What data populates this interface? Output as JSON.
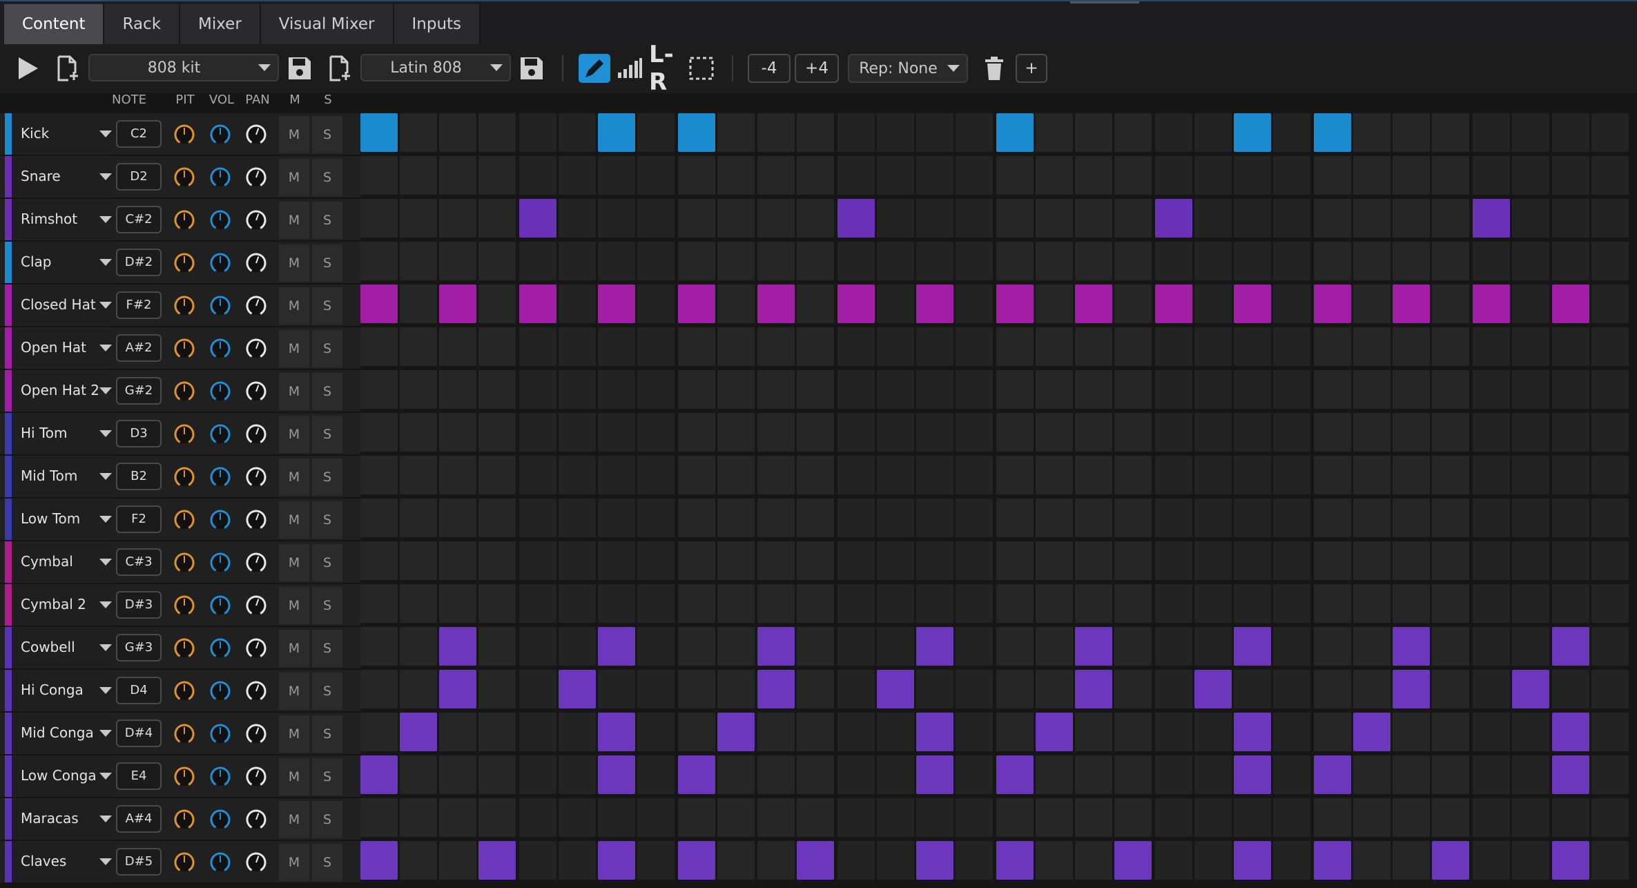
{
  "tabs": [
    {
      "label": "Content",
      "active": true
    },
    {
      "label": "Rack",
      "active": false
    },
    {
      "label": "Mixer",
      "active": false
    },
    {
      "label": "Visual Mixer",
      "active": false
    },
    {
      "label": "Inputs",
      "active": false
    }
  ],
  "toolbar": {
    "kit_select": "808 kit",
    "pattern_select": "Latin 808",
    "transpose_down": "-4",
    "transpose_up": "+4",
    "repeat_select": "Rep: None",
    "add_label": "+",
    "lr_label": "L-R",
    "icons": [
      "play-icon",
      "new-file-icon",
      "save-icon",
      "new-file-icon",
      "save-icon",
      "pencil-icon",
      "velocity-icon",
      "lr-icon",
      "select-icon",
      "trash-icon"
    ]
  },
  "columns": {
    "note": "NOTE",
    "pitch": "PIT",
    "volume": "VOL",
    "pan": "PAN",
    "mute": "M",
    "solo": "S"
  },
  "colors": {
    "blue": "#1d8ad0",
    "violet_dark": "#6a32b8",
    "magenta": "#a31ea6",
    "purple": "#6b38bd",
    "knob_pitch": "#e0922c",
    "knob_volume": "#1f8fd6",
    "knob_pan": "#e8e8e8",
    "accent_tool": "#1f8fd6"
  },
  "tracks": [
    {
      "name": "Kick",
      "note": "C2",
      "mute": "M",
      "solo": "S",
      "color": "#1d8ad0"
    },
    {
      "name": "Snare",
      "note": "D2",
      "mute": "M",
      "solo": "S",
      "color": "#6a2fb0"
    },
    {
      "name": "Rimshot",
      "note": "C#2",
      "mute": "M",
      "solo": "S",
      "color": "#6a2fb0"
    },
    {
      "name": "Clap",
      "note": "D#2",
      "mute": "M",
      "solo": "S",
      "color": "#1d8ad0"
    },
    {
      "name": "Closed Hat",
      "note": "F#2",
      "mute": "M",
      "solo": "S",
      "color": "#a31ea6"
    },
    {
      "name": "Open Hat",
      "note": "A#2",
      "mute": "M",
      "solo": "S",
      "color": "#a31ea6"
    },
    {
      "name": "Open Hat 2",
      "note": "G#2",
      "mute": "M",
      "solo": "S",
      "color": "#a31ea6"
    },
    {
      "name": "Hi Tom",
      "note": "D3",
      "mute": "M",
      "solo": "S",
      "color": "#3a3aa8"
    },
    {
      "name": "Mid Tom",
      "note": "B2",
      "mute": "M",
      "solo": "S",
      "color": "#3a3aa8"
    },
    {
      "name": "Low Tom",
      "note": "F2",
      "mute": "M",
      "solo": "S",
      "color": "#3a3aa8"
    },
    {
      "name": "Cymbal",
      "note": "C#3",
      "mute": "M",
      "solo": "S",
      "color": "#b01c8c"
    },
    {
      "name": "Cymbal 2",
      "note": "D#3",
      "mute": "M",
      "solo": "S",
      "color": "#b01c8c"
    },
    {
      "name": "Cowbell",
      "note": "G#3",
      "mute": "M",
      "solo": "S",
      "color": "#5a34b8"
    },
    {
      "name": "Hi Conga",
      "note": "D4",
      "mute": "M",
      "solo": "S",
      "color": "#5a34b8"
    },
    {
      "name": "Mid Conga",
      "note": "D#4",
      "mute": "M",
      "solo": "S",
      "color": "#5a34b8"
    },
    {
      "name": "Low Conga",
      "note": "E4",
      "mute": "M",
      "solo": "S",
      "color": "#5a34b8"
    },
    {
      "name": "Maracas",
      "note": "A#4",
      "mute": "M",
      "solo": "S",
      "color": "#5a34b8"
    },
    {
      "name": "Claves",
      "note": "D#5",
      "mute": "M",
      "solo": "S",
      "color": "#5a34b8"
    }
  ],
  "grid": {
    "steps": 32,
    "rows": [
      {
        "color": "#1b8bd0",
        "on": [
          0,
          6,
          8,
          16,
          22,
          24
        ]
      },
      {
        "color": "#6a32b8",
        "on": []
      },
      {
        "color": "#6a32b8",
        "on": [
          4,
          12,
          20,
          28
        ]
      },
      {
        "color": "#1b8bd0",
        "on": []
      },
      {
        "color": "#a31ea6",
        "on": [
          0,
          2,
          4,
          6,
          8,
          10,
          12,
          14,
          16,
          18,
          20,
          22,
          24,
          26,
          28,
          30
        ]
      },
      {
        "color": "#a31ea6",
        "on": []
      },
      {
        "color": "#a31ea6",
        "on": []
      },
      {
        "color": "#5a34b8",
        "on": []
      },
      {
        "color": "#5a34b8",
        "on": []
      },
      {
        "color": "#5a34b8",
        "on": []
      },
      {
        "color": "#a31ea6",
        "on": []
      },
      {
        "color": "#a31ea6",
        "on": []
      },
      {
        "color": "#6b38bd",
        "on": [
          2,
          6,
          10,
          14,
          18,
          22,
          26,
          30
        ]
      },
      {
        "color": "#6b38bd",
        "on": [
          2,
          5,
          10,
          13,
          18,
          21,
          26,
          29
        ]
      },
      {
        "color": "#6b38bd",
        "on": [
          1,
          6,
          9,
          14,
          17,
          22,
          25,
          30
        ]
      },
      {
        "color": "#6b38bd",
        "on": [
          0,
          6,
          8,
          14,
          16,
          22,
          24,
          30
        ]
      },
      {
        "color": "#6b38bd",
        "on": []
      },
      {
        "color": "#6b38bd",
        "on": [
          0,
          3,
          6,
          8,
          11,
          14,
          16,
          19,
          22,
          24,
          27,
          30
        ]
      }
    ]
  }
}
